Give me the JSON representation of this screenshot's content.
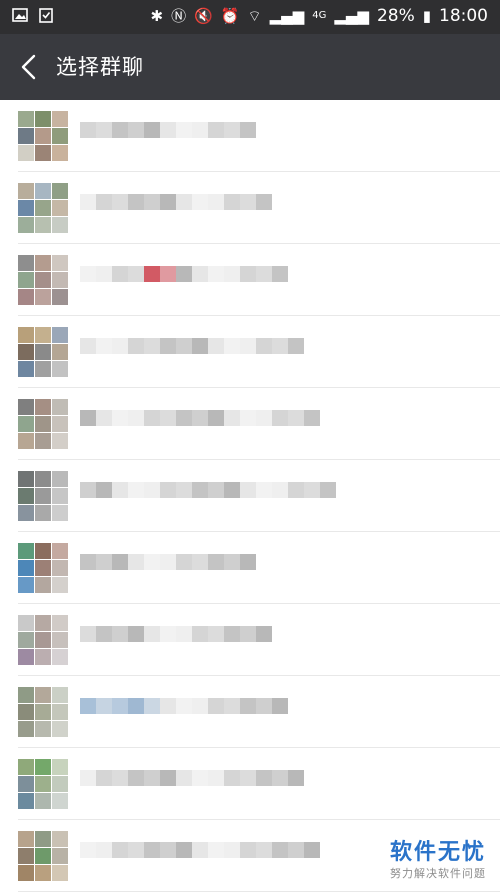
{
  "status_bar": {
    "battery": "28%",
    "time": "18:00",
    "network": "4G"
  },
  "header": {
    "title": "选择群聊"
  },
  "watermark": {
    "main": "软件无忧",
    "sub": "努力解决软件问题"
  },
  "groups": [
    {
      "colors": [
        "#9aa98e",
        "#7d8f6a",
        "#c7b3a0",
        "#6e7a86",
        "#b49a8a",
        "#8f9c7c",
        "#d2cfc5",
        "#9b8476",
        "#c9b29c"
      ]
    },
    {
      "colors": [
        "#b8ad9b",
        "#a7b6c2",
        "#8f9f86",
        "#6b88a7",
        "#97a58b",
        "#c5b8a6",
        "#9cae9a",
        "#b7c0b0",
        "#c7ccc4"
      ]
    },
    {
      "colors": [
        "#8e8e8e",
        "#b49c8f",
        "#cfc7c0",
        "#8fa58e",
        "#a58f8a",
        "#c3b9b3",
        "#a58686",
        "#bba29c",
        "#9c9191"
      ]
    },
    {
      "colors": [
        "#b8a07a",
        "#c4b08e",
        "#9aa7b8",
        "#7c6c5e",
        "#8a8a8a",
        "#b4a694",
        "#6e86a0",
        "#a0a0a0",
        "#c2c2c2"
      ]
    },
    {
      "colors": [
        "#7f7f7f",
        "#a58f84",
        "#c0bcb5",
        "#8fa58e",
        "#9f9589",
        "#c8c2bb",
        "#b7a693",
        "#a89d93",
        "#d3cec8"
      ]
    },
    {
      "colors": [
        "#707474",
        "#8c8c8c",
        "#b9b9b9",
        "#6b7b70",
        "#9a9a9a",
        "#c6c6c6",
        "#88939e",
        "#a9a9a9",
        "#cdcdcd"
      ]
    },
    {
      "colors": [
        "#5c9a7a",
        "#8b6d5e",
        "#c4a9a0",
        "#4d87b8",
        "#9c8076",
        "#c2b7b1",
        "#6799c6",
        "#b3a79f",
        "#d4d0cc"
      ]
    },
    {
      "colors": [
        "#c9c9c9",
        "#b6a9a3",
        "#d1cbc7",
        "#9fa99e",
        "#a89894",
        "#c7c0bc",
        "#9d8aa2",
        "#bbaeb0",
        "#d6d1d3"
      ]
    },
    {
      "colors": [
        "#8f9b86",
        "#b3a89a",
        "#cbd0c6",
        "#8a8c7a",
        "#a7ab96",
        "#c4c7bb",
        "#989c8c",
        "#b7b9ae",
        "#d0d2ca"
      ]
    },
    {
      "colors": [
        "#8fa97a",
        "#74a86a",
        "#c7d3bd",
        "#7d8f9a",
        "#9db08c",
        "#c2cbbd",
        "#6b8a9e",
        "#adb7ae",
        "#cfd5d0"
      ]
    },
    {
      "colors": [
        "#b7a38c",
        "#8f9b86",
        "#c9c1b4",
        "#8e7e6c",
        "#6e9a6a",
        "#b8b2a6",
        "#a08566",
        "#b9a07f",
        "#d3c7b4"
      ]
    }
  ]
}
